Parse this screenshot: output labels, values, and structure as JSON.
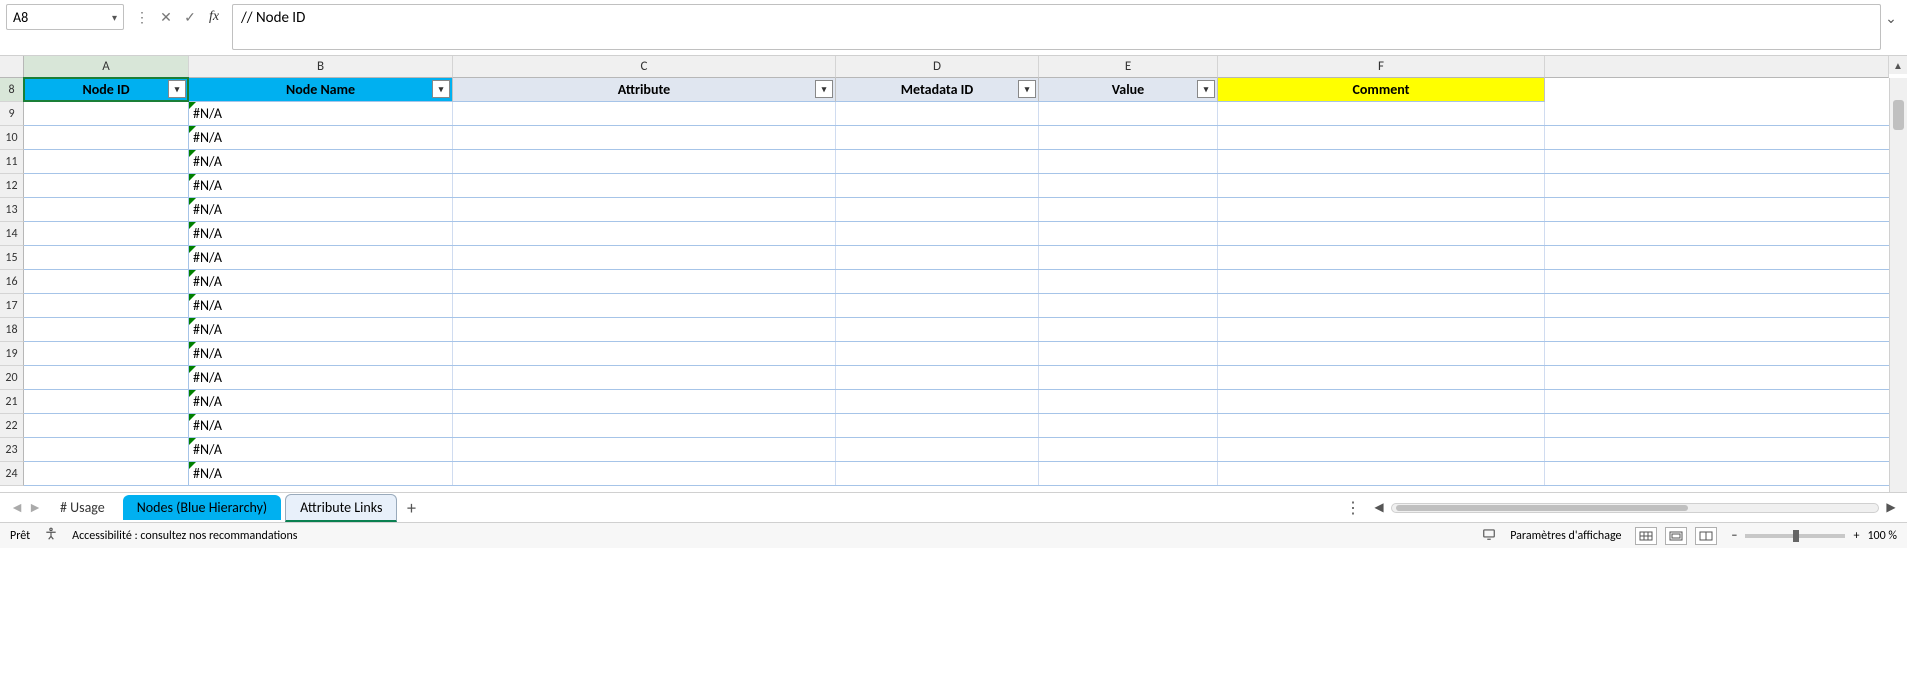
{
  "formula_bar": {
    "cell_ref": "A8",
    "cancel_glyph": "✕",
    "accept_glyph": "✓",
    "fx_label": "fx",
    "content": "// Node ID"
  },
  "column_headers": [
    "A",
    "B",
    "C",
    "D",
    "E",
    "F"
  ],
  "table_headers": {
    "A": "Node ID",
    "B": "Node Name",
    "C": "Attribute",
    "D": "Metadata ID",
    "E": "Value",
    "F": "Comment"
  },
  "row_start": 8,
  "row_end": 24,
  "na_text": "#N/A",
  "sheet_tabs": {
    "nav_first": "◄",
    "nav_last": "►",
    "usage": "# Usage",
    "nodes": "Nodes (Blue Hierarchy)",
    "attr": "Attribute Links",
    "add": "+"
  },
  "status": {
    "ready": "Prêt",
    "accessibility": "Accessibilité : consultez nos recommandations",
    "display_settings": "Paramètres d'affichage",
    "zoom_minus": "−",
    "zoom_plus": "+",
    "zoom_pct": "100 %"
  }
}
